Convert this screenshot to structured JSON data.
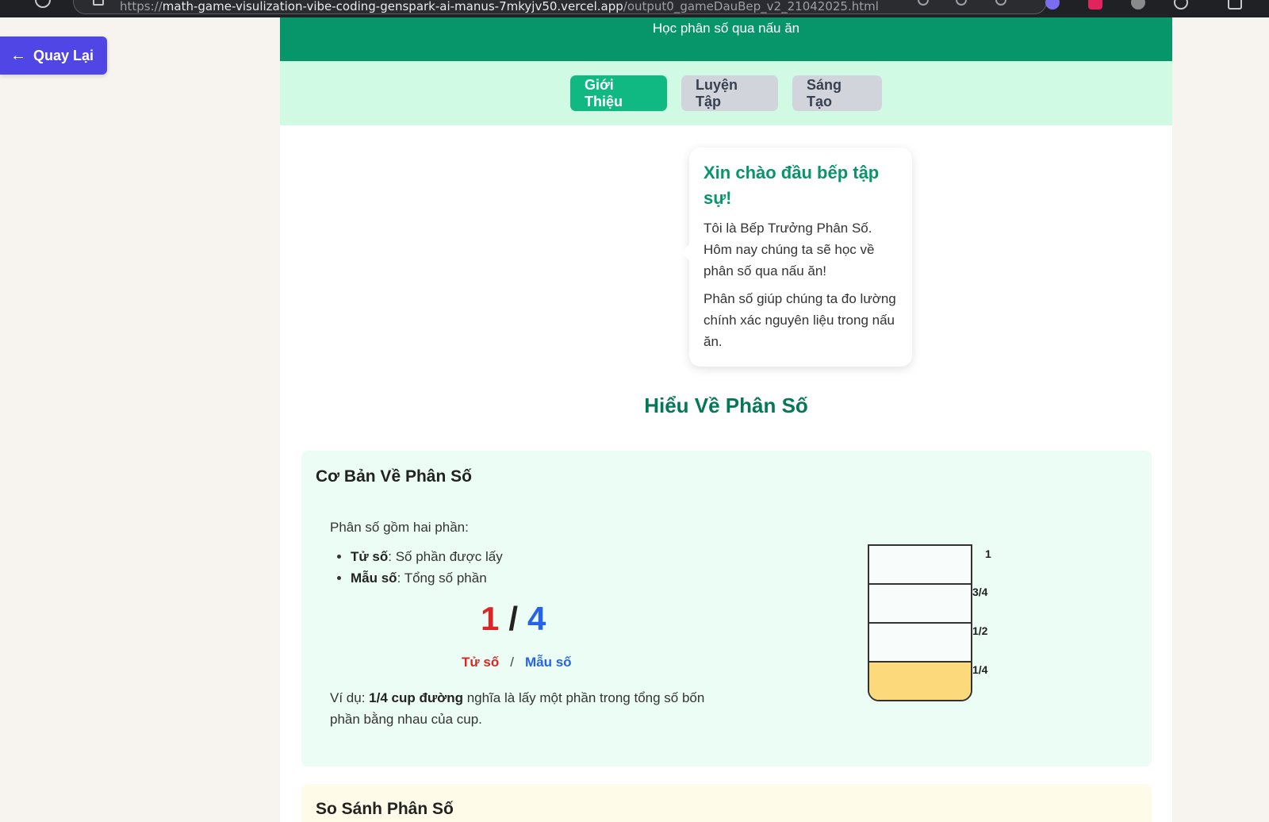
{
  "browser": {
    "url_prefix": "https://",
    "url_host": "math-game-visulization-vibe-coding-genspark-ai-manus-7mkyjv50.vercel.app",
    "url_path": "/output0_gameDauBep_v2_21042025.html"
  },
  "back_button": {
    "label": "Quay Lại",
    "icon": "arrow-left-icon"
  },
  "header": {
    "subtitle": "Học phân số qua nấu ăn"
  },
  "tabs": [
    {
      "label": "Giới Thiệu",
      "active": true
    },
    {
      "label": "Luyện Tập",
      "active": false
    },
    {
      "label": "Sáng Tạo",
      "active": false
    }
  ],
  "chef_bubble": {
    "title": "Xin chào đầu bếp tập sự!",
    "para1": "Tôi là Bếp Trưởng Phân Số. Hôm nay chúng ta sẽ học về phân số qua nấu ăn!",
    "para2": "Phân số giúp chúng ta đo lường chính xác nguyên liệu trong nấu ăn."
  },
  "section_title": "Hiểu Về Phân Số",
  "basics_card": {
    "title": "Cơ Bản Về Phân Số",
    "intro": "Phân số gồm hai phần:",
    "items": [
      {
        "term": "Tử số",
        "desc": ": Số phần được lấy"
      },
      {
        "term": "Mẫu số",
        "desc": ": Tổng số phần"
      }
    ],
    "fraction": {
      "numerator": "1",
      "slash": "/",
      "denominator": "4"
    },
    "labels": {
      "numerator": "Tử số",
      "separator": "/",
      "denominator": "Mẫu số"
    },
    "example": {
      "prefix": "Ví dụ: ",
      "bold": "1/4 cup đường",
      "rest": " nghĩa là lấy một phần trong tổng số bốn phần bằng nhau của cup."
    }
  },
  "measuring_cup": {
    "fill_fraction": 0.25,
    "fill_color": "#fcd97a",
    "marks": [
      "1",
      "3/4",
      "1/2",
      "1/4"
    ]
  },
  "next_card": {
    "title": "So Sánh Phân Số"
  },
  "colors": {
    "header_green": "#069669",
    "tab_active": "#10b981",
    "tab_bar_bg": "#d1fae5",
    "back_button": "#5046e5",
    "numerator_red": "#dc2626",
    "denominator_blue": "#2563eb"
  }
}
